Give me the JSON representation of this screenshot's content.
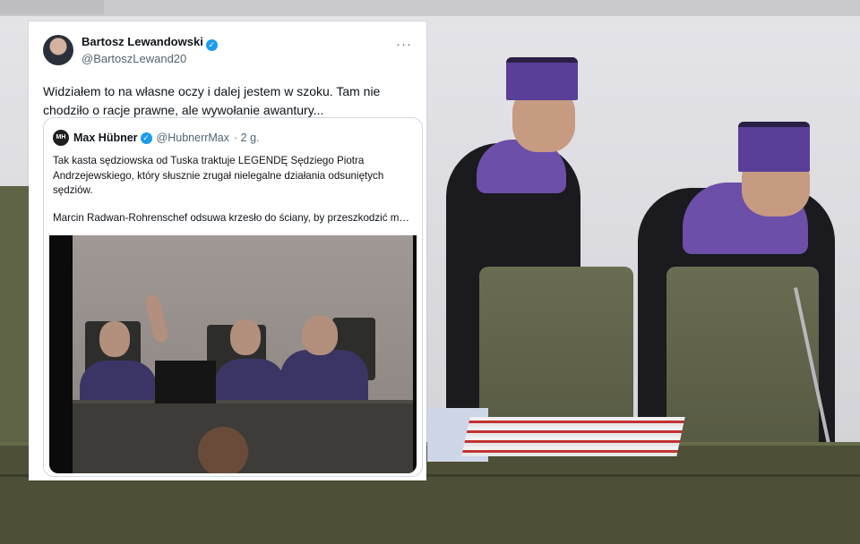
{
  "tweet": {
    "author_name": "Bartosz Lewandowski",
    "author_handle": "@BartoszLewand20",
    "verified_mark": "✓",
    "more_label": "···",
    "text": "Widziałem to na własne oczy i dalej jestem w szoku. Tam nie chodziło o racje prawne, ale wywołanie awantury...",
    "quote": {
      "avatar_initials": "MH",
      "author_name": "Max Hübner",
      "author_handle": "@HubnerrMax",
      "time_ago": "· 2 g.",
      "paragraph_1": "Tak kasta sędziowska od Tuska traktuje LEGENDĘ Sędziego Piotra Andrzejewskiego, który słusznie zrugał nielegalne działania odsuniętych sędziów.",
      "paragraph_2": "Marcin Radwan-Rohrenschef odsuwa krzesło do ściany, by przeszkodzić mu..."
    }
  },
  "colors": {
    "verified_blue": "#1d9bf0",
    "robe_purple": "#5a3f98",
    "text_primary": "#0f1419",
    "text_secondary": "#536471"
  },
  "icons": {
    "verified": "verified-badge-icon",
    "more": "more-options-icon"
  }
}
